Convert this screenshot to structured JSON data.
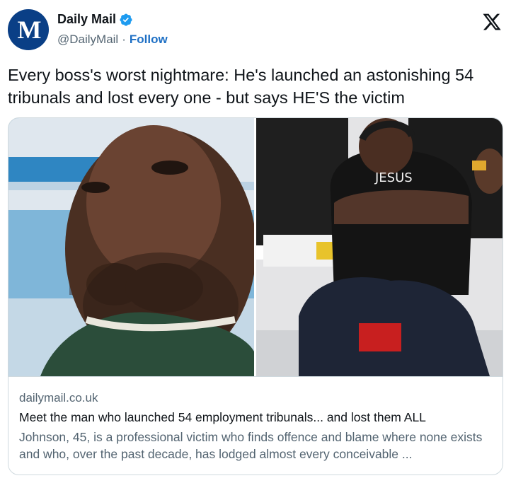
{
  "author": {
    "display_name": "Daily Mail",
    "handle": "@DailyMail",
    "separator": "·",
    "follow_label": "Follow",
    "avatar_letter": "M",
    "verified_color": "#1d9bf0",
    "avatar_color": "#0a3f86"
  },
  "tweet": {
    "text": "Every boss's worst nightmare: He's launched an astonishing 54 tribunals and lost every one - but says HE'S the victim"
  },
  "card": {
    "domain": "dailymail.co.uk",
    "title": "Meet the man who launched 54 employment tribunals... and lost them ALL",
    "description": "Johnson, 45, is a professional victim who finds offence and blame where none exists and who, over the past decade, has lodged almost every conceivable ...",
    "right_photo_shirt_text": "JESUS"
  },
  "icons": {
    "logo": "x-logo-icon",
    "verified": "verified-badge-icon"
  }
}
